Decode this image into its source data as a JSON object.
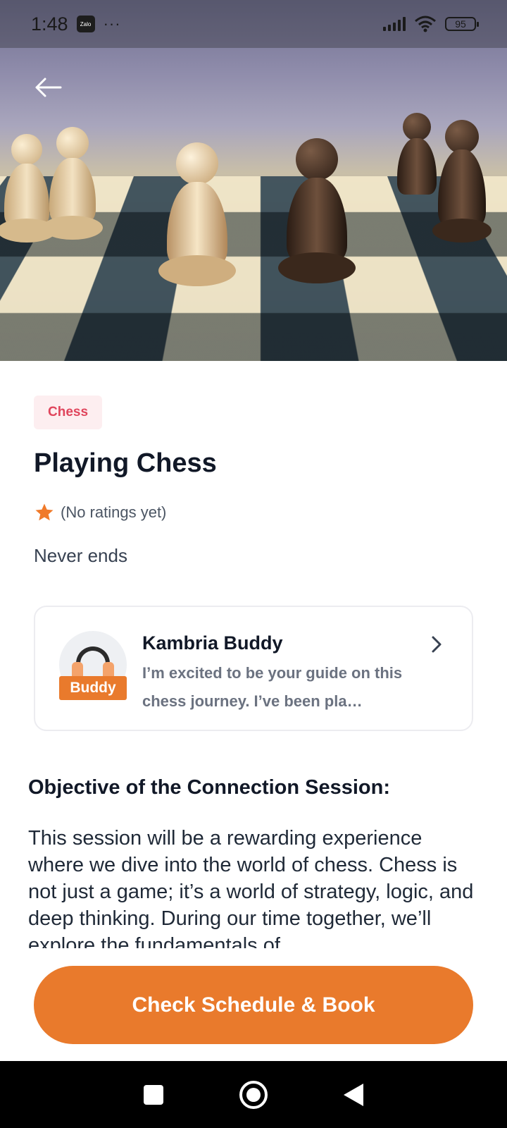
{
  "status_bar": {
    "time": "1:48",
    "zalo_label": "Zalo",
    "more": "···",
    "battery": "95"
  },
  "hero": {
    "image_icon": "chess-pawns-photo",
    "back_icon": "arrow-left-icon"
  },
  "activity": {
    "category": "Chess",
    "title": "Playing Chess",
    "rating_text": "(No ratings yet)",
    "subtitle": "Never ends"
  },
  "buddy": {
    "name": "Kambria Buddy",
    "badge": "Buddy",
    "description": "I’m excited to be your guide on this chess journey. I’ve been pla…"
  },
  "objective": {
    "heading": "Objective of the Connection Session:",
    "body": "This session will be a rewarding experience where we dive into the world of chess. Chess is not just a game; it’s a world of strategy, logic, and deep thinking. During our time together, we’ll explore the fundamentals of"
  },
  "cta": {
    "label": "Check Schedule & Book"
  },
  "colors": {
    "accent": "#e97a2c",
    "chip_text": "#e0455c",
    "chip_bg": "#fdeef0",
    "star": "#f07a2a"
  }
}
